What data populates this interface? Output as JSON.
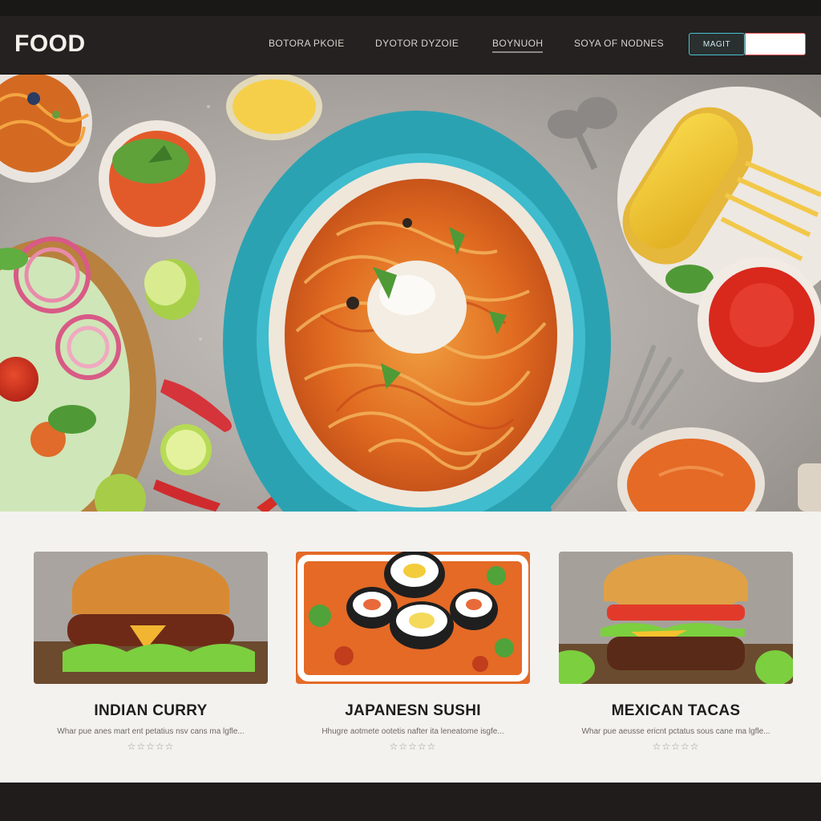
{
  "header": {
    "logo": "FOOD",
    "nav": [
      "BOTORA PKOIE",
      "DYOTOR DYZOIE",
      "BOYNUOH",
      "SOYA OF NODNES"
    ],
    "search_button": "MAGIT",
    "search_placeholder": ""
  },
  "hero": {
    "icon": "food-spread-photo"
  },
  "cards": [
    {
      "title": "INDIAN CURRY",
      "description": "Whar pue anes mart ent petatius nsv cans ma lgfle...",
      "rating_text": "☆☆☆☆☆",
      "icon": "burger-photo"
    },
    {
      "title": "JAPANESN SUSHI",
      "description": "Hhugre aotmete ootetis nafter ita leneatome isgfe...",
      "rating_text": "☆☆☆☆☆",
      "icon": "sushi-photo"
    },
    {
      "title": "MEXICAN TACAS",
      "description": "Whar pue aeusse ericnt pctatus sous cane ma lgfle...",
      "rating_text": "☆☆☆☆☆",
      "icon": "burger-photo"
    }
  ],
  "colors": {
    "header_bg": "#242120",
    "accent_teal": "#47c3cf",
    "accent_red": "#e35a5a",
    "card_section_bg": "#f3f2ef"
  }
}
